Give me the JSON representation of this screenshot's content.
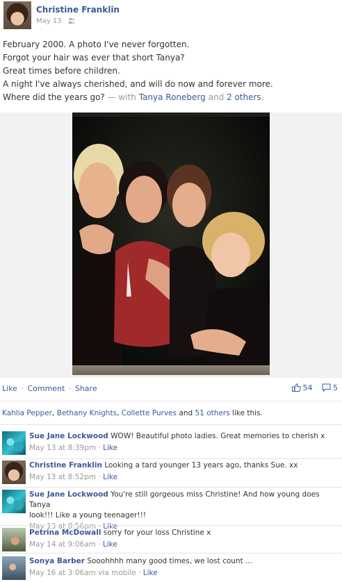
{
  "post": {
    "author": "Christine Franklin",
    "date": "May 13",
    "audience_icon": "friends-icon",
    "lines": [
      "February 2000. A photo I've never forgotten.",
      "Forgot your hair was ever that short Tanya?",
      "Great times before children.",
      "A night I've always cherished, and will do now and forever more."
    ],
    "last_line_text": "Where did the years go?",
    "with_prefix": "— with",
    "tagged_person": "Tanya Roneberg",
    "and_word": "and",
    "others_link": "2 others",
    "period": "."
  },
  "actions": {
    "like": "Like",
    "comment": "Comment",
    "share": "Share",
    "separator": "·"
  },
  "counts": {
    "likes": "54",
    "comments": "5"
  },
  "likes_summary": {
    "names": [
      "Kahlia Pepper",
      "Bethany Knights",
      "Collette Purves"
    ],
    "sep1": ", ",
    "sep2": ", ",
    "and_text": " and ",
    "others_link": "51 others",
    "suffix": " like this."
  },
  "comments": [
    {
      "author": "Sue Jane Lockwood",
      "text": "WOW! Beautiful photo ladies. Great memories to cherish x",
      "time": "May 13 at 8:39pm",
      "via": "",
      "like": "Like",
      "avatar": "water"
    },
    {
      "author": "Christine Franklin",
      "text": "Looking a tard younger 13 years ago, thanks Sue. xx",
      "time": "May 13 at 8:52pm",
      "via": "",
      "like": "Like",
      "avatar": "christine"
    },
    {
      "author": "Sue Jane Lockwood",
      "text": "You're still gorgeous miss Christine! And how young does Tanya",
      "text2": "look!!! Like a young teenager!!!",
      "time": "May 13 at 8:56pm",
      "via": "",
      "like": "Like",
      "avatar": "water"
    },
    {
      "author": "Petrina McDowall",
      "text": "sorry for your loss Christine x",
      "time": "May 14 at 9:06am",
      "via": "",
      "like": "Like",
      "avatar": "petrina"
    },
    {
      "author": "Sonya Barber",
      "text": "Sooohhhh many good times, we lost count ...",
      "time": "May 16 at 3:06am",
      "via": "via mobile",
      "like": "Like",
      "avatar": "sonya"
    }
  ],
  "colors": {
    "link": "#3b5998",
    "meta": "#999999",
    "divider": "#e5e5e5"
  }
}
